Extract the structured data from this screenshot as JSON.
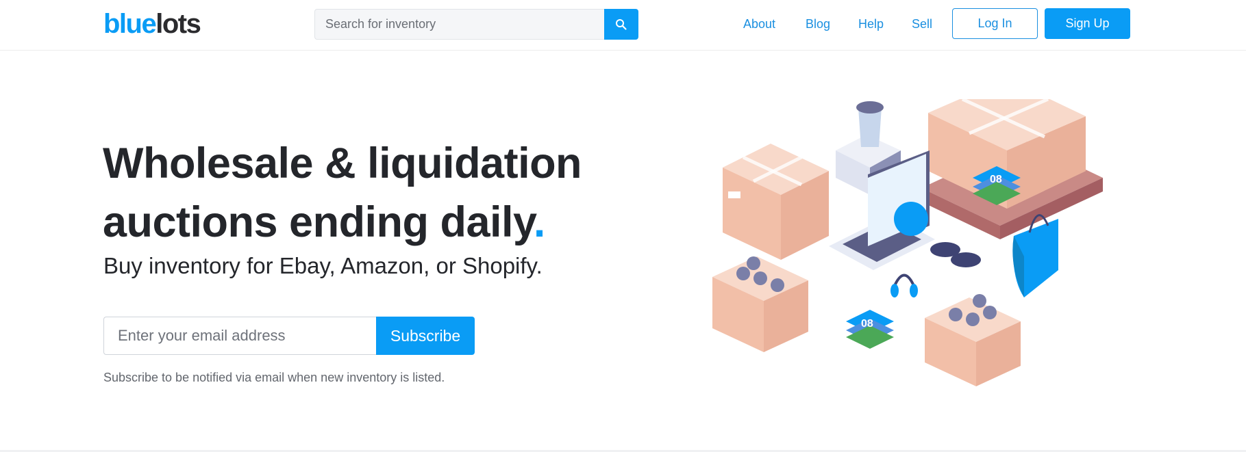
{
  "header": {
    "logo": {
      "part1": "blue",
      "part2": "lots"
    },
    "search": {
      "placeholder": "Search for inventory",
      "value": "",
      "button_icon": "search-icon"
    },
    "nav": [
      {
        "label": "About"
      },
      {
        "label": "Blog"
      },
      {
        "label": "Help"
      },
      {
        "label": "Sell"
      }
    ],
    "login_label": "Log In",
    "signup_label": "Sign Up"
  },
  "hero": {
    "title_line1": "Wholesale & liquidation",
    "title_line2": "auctions ending daily",
    "title_dot": ".",
    "subtitle": "Buy inventory for Ebay, Amazon, or Shopify.",
    "email": {
      "placeholder": "Enter your email address",
      "value": ""
    },
    "subscribe_label": "Subscribe",
    "note": "Subscribe to be notified via email when new inventory is listed.",
    "illustration": {
      "description": "isometric-inventory-illustration",
      "jersey_number": "08"
    }
  },
  "colors": {
    "accent": "#0a9cf5",
    "link": "#1a8fe0",
    "text": "#24262b",
    "muted": "#62666d"
  }
}
